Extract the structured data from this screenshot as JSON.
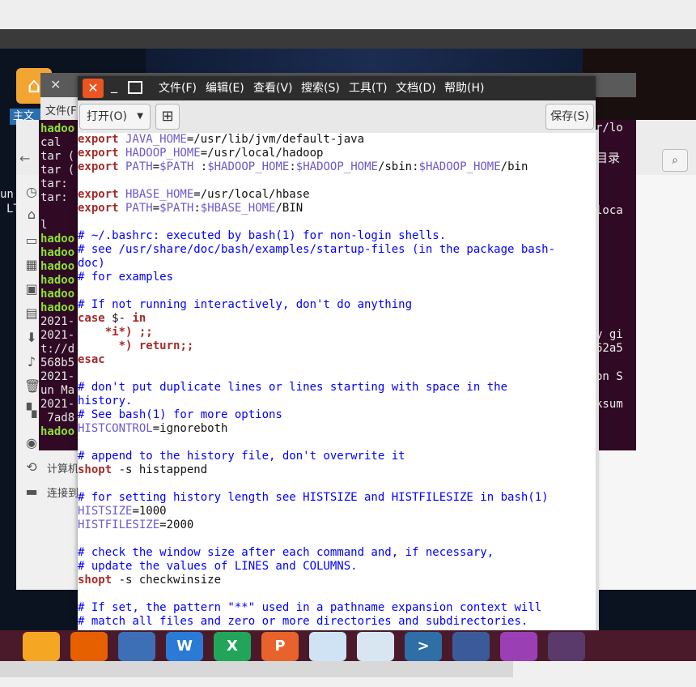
{
  "desktop": {
    "home_label": "主文",
    "left_texts": [
      "un",
      "LT"
    ]
  },
  "secondary_window": {
    "close_glyph": "✕",
    "menu_label": "文件(F"
  },
  "file_manager": {
    "right_texts": [
      "r/lo",
      "目录",
      "loca",
      "y gi",
      "62a5",
      "on S",
      "ksum"
    ],
    "side_items": [
      "计算机",
      "连接到"
    ],
    "search_glyph": "⌕"
  },
  "terminal": {
    "lines": [
      {
        "t": "hadoo",
        "g": true
      },
      {
        "t": "cal",
        "g": false
      },
      {
        "t": "tar (",
        "g": false
      },
      {
        "t": "tar (",
        "g": false
      },
      {
        "t": "tar:",
        "g": false
      },
      {
        "t": "tar:",
        "g": false
      },
      {
        "t": "",
        "g": false
      },
      {
        "t": "l",
        "g": false
      },
      {
        "t": "hadoo",
        "g": true
      },
      {
        "t": "hadoo",
        "g": true
      },
      {
        "t": "hadoo",
        "g": true
      },
      {
        "t": "hadoo",
        "g": true
      },
      {
        "t": "hadoo",
        "g": true
      },
      {
        "t": "hadoo",
        "g": true
      },
      {
        "t": "2021-",
        "g": false
      },
      {
        "t": "2021-",
        "g": false
      },
      {
        "t": "t://d",
        "g": false
      },
      {
        "t": "568b5",
        "g": false
      },
      {
        "t": "2021-",
        "g": false
      },
      {
        "t": "un Ma",
        "g": false
      },
      {
        "t": "2021-",
        "g": false
      },
      {
        "t": " 7ad8",
        "g": false
      },
      {
        "t": "hadoo",
        "g": true
      }
    ]
  },
  "editor": {
    "menu": [
      "文件(F)",
      "编辑(E)",
      "查看(V)",
      "搜索(S)",
      "工具(T)",
      "文档(D)",
      "帮助(H)"
    ],
    "open_label": "打开(O)",
    "save_label": "保存(S)",
    "new_tab_glyph": "⊞",
    "code_lines": [
      [
        [
          "kw",
          "export"
        ],
        [
          "var",
          " JAVA_HOME"
        ],
        [
          "",
          "=/usr/lib/jvm/default-java"
        ]
      ],
      [
        [
          "kw",
          "export"
        ],
        [
          "var",
          " HADOOP_HOME"
        ],
        [
          "",
          "=/usr/local/hadoop"
        ]
      ],
      [
        [
          "kw",
          "export"
        ],
        [
          "var",
          " PATH"
        ],
        [
          "",
          "="
        ],
        [
          "var",
          "$PATH"
        ],
        [
          "",
          " :"
        ],
        [
          "var",
          "$HADOOP_HOME"
        ],
        [
          "",
          ":"
        ],
        [
          "var",
          "$HADOOP_HOME"
        ],
        [
          "",
          "/sbin:"
        ],
        [
          "var",
          "$HADOOP_HOME"
        ],
        [
          "",
          "/bin"
        ]
      ],
      [],
      [
        [
          "kw",
          "export"
        ],
        [
          "var",
          " HBASE_HOME"
        ],
        [
          "",
          "=/usr/local/hbase"
        ]
      ],
      [
        [
          "kw",
          "export"
        ],
        [
          "var",
          " PATH"
        ],
        [
          "",
          "="
        ],
        [
          "var",
          "$PATH"
        ],
        [
          "",
          ":"
        ],
        [
          "var",
          "$HBASE_HOME"
        ],
        [
          "",
          "/BIN"
        ]
      ],
      [],
      [
        [
          "cm",
          "# ~/.bashrc: executed by bash(1) for non-login shells."
        ]
      ],
      [
        [
          "cm",
          "# see /usr/share/doc/bash/examples/startup-files (in the package bash-"
        ]
      ],
      [
        [
          "cm",
          "doc)"
        ]
      ],
      [
        [
          "cm",
          "# for examples"
        ]
      ],
      [],
      [
        [
          "cm",
          "# If not running interactively, don't do anything"
        ]
      ],
      [
        [
          "kw",
          "case"
        ],
        [
          "",
          " $- "
        ],
        [
          "kw",
          "in"
        ]
      ],
      [
        [
          "",
          "    "
        ],
        [
          "kw",
          "*i*)"
        ],
        [
          "",
          " "
        ],
        [
          "kw",
          ";;"
        ]
      ],
      [
        [
          "",
          "      "
        ],
        [
          "kw",
          "*) return"
        ],
        [
          "",
          ""
        ],
        [
          "kw",
          ";;"
        ]
      ],
      [
        [
          "kw",
          "esac"
        ]
      ],
      [],
      [
        [
          "cm",
          "# don't put duplicate lines or lines starting with space in the"
        ]
      ],
      [
        [
          "cm",
          "history."
        ]
      ],
      [
        [
          "cm",
          "# See bash(1) for more options"
        ]
      ],
      [
        [
          "var",
          "HISTCONTROL"
        ],
        [
          "",
          "=ignoreboth"
        ]
      ],
      [],
      [
        [
          "cm",
          "# append to the history file, don't overwrite it"
        ]
      ],
      [
        [
          "kw",
          "shopt"
        ],
        [
          "",
          " -s histappend"
        ]
      ],
      [],
      [
        [
          "cm",
          "# for setting history length see HISTSIZE and HISTFILESIZE in bash(1)"
        ]
      ],
      [
        [
          "var",
          "HISTSIZE"
        ],
        [
          "",
          "=1000"
        ]
      ],
      [
        [
          "var",
          "HISTFILESIZE"
        ],
        [
          "",
          "=2000"
        ]
      ],
      [],
      [
        [
          "cm",
          "# check the window size after each command and, if necessary,"
        ]
      ],
      [
        [
          "cm",
          "# update the values of LINES and COLUMNS."
        ]
      ],
      [
        [
          "kw",
          "shopt"
        ],
        [
          "",
          " -s checkwinsize"
        ]
      ],
      [],
      [
        [
          "cm",
          "# If set, the pattern \"**\" used in a pathname expansion context will"
        ]
      ],
      [
        [
          "cm",
          "# match all files and zero or more directories and subdirectories."
        ]
      ]
    ]
  },
  "taskbar": {
    "apps": [
      {
        "name": "files-app",
        "label": "",
        "color": "#f5a623"
      },
      {
        "name": "firefox-app",
        "label": "",
        "color": "#e66000"
      },
      {
        "name": "browser-app",
        "label": "",
        "color": "#3d6fb6"
      },
      {
        "name": "wps-writer-app",
        "label": "W",
        "color": "#2b7bd6"
      },
      {
        "name": "wps-spreadsheet-app",
        "label": "X",
        "color": "#22a55a"
      },
      {
        "name": "wps-presentation-app",
        "label": "P",
        "color": "#e8632b"
      },
      {
        "name": "software-center-app",
        "label": "",
        "color": "#cfe3f5"
      },
      {
        "name": "vm-app",
        "label": "",
        "color": "#d8e6f2"
      },
      {
        "name": "vscode-app",
        "label": ">",
        "color": "#2f6ea7"
      },
      {
        "name": "screenshot-app",
        "label": "",
        "color": "#3b5a9a"
      },
      {
        "name": "eraser-app",
        "label": "",
        "color": "#9b3fb5"
      },
      {
        "name": "disc-app",
        "label": "",
        "color": "#5a3a6a"
      }
    ]
  }
}
